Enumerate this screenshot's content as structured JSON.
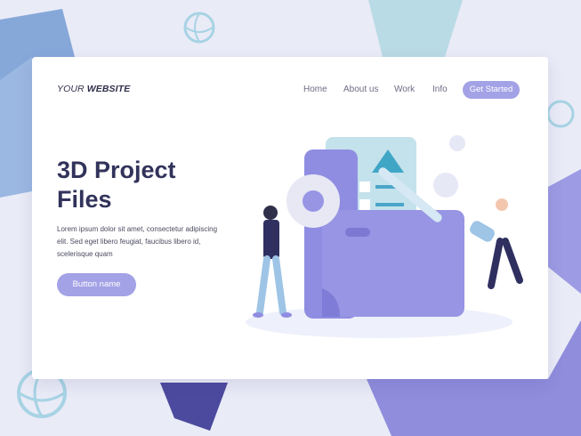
{
  "brand": {
    "prefix": "YOUR ",
    "name": "WEBSITE"
  },
  "nav": {
    "items": [
      {
        "label": "Home"
      },
      {
        "label": "About us"
      },
      {
        "label": "Work"
      },
      {
        "label": "Info"
      }
    ],
    "cta_label": "Get Started"
  },
  "hero": {
    "title_line1": "3D Project",
    "title_line2": "Files",
    "body_line1": "Lorem ipsum dolor sit amet, consectetur adipiscing",
    "body_line2": "elit. Sed eget libero feugiat, faucibus libero id,",
    "body_line3": "scelerisque quam",
    "button_label": "Button name"
  },
  "colors": {
    "background": "#e9ebf7",
    "accent": "#a3a2e6",
    "heading": "#32335b",
    "folder": "#8e8ce0"
  }
}
